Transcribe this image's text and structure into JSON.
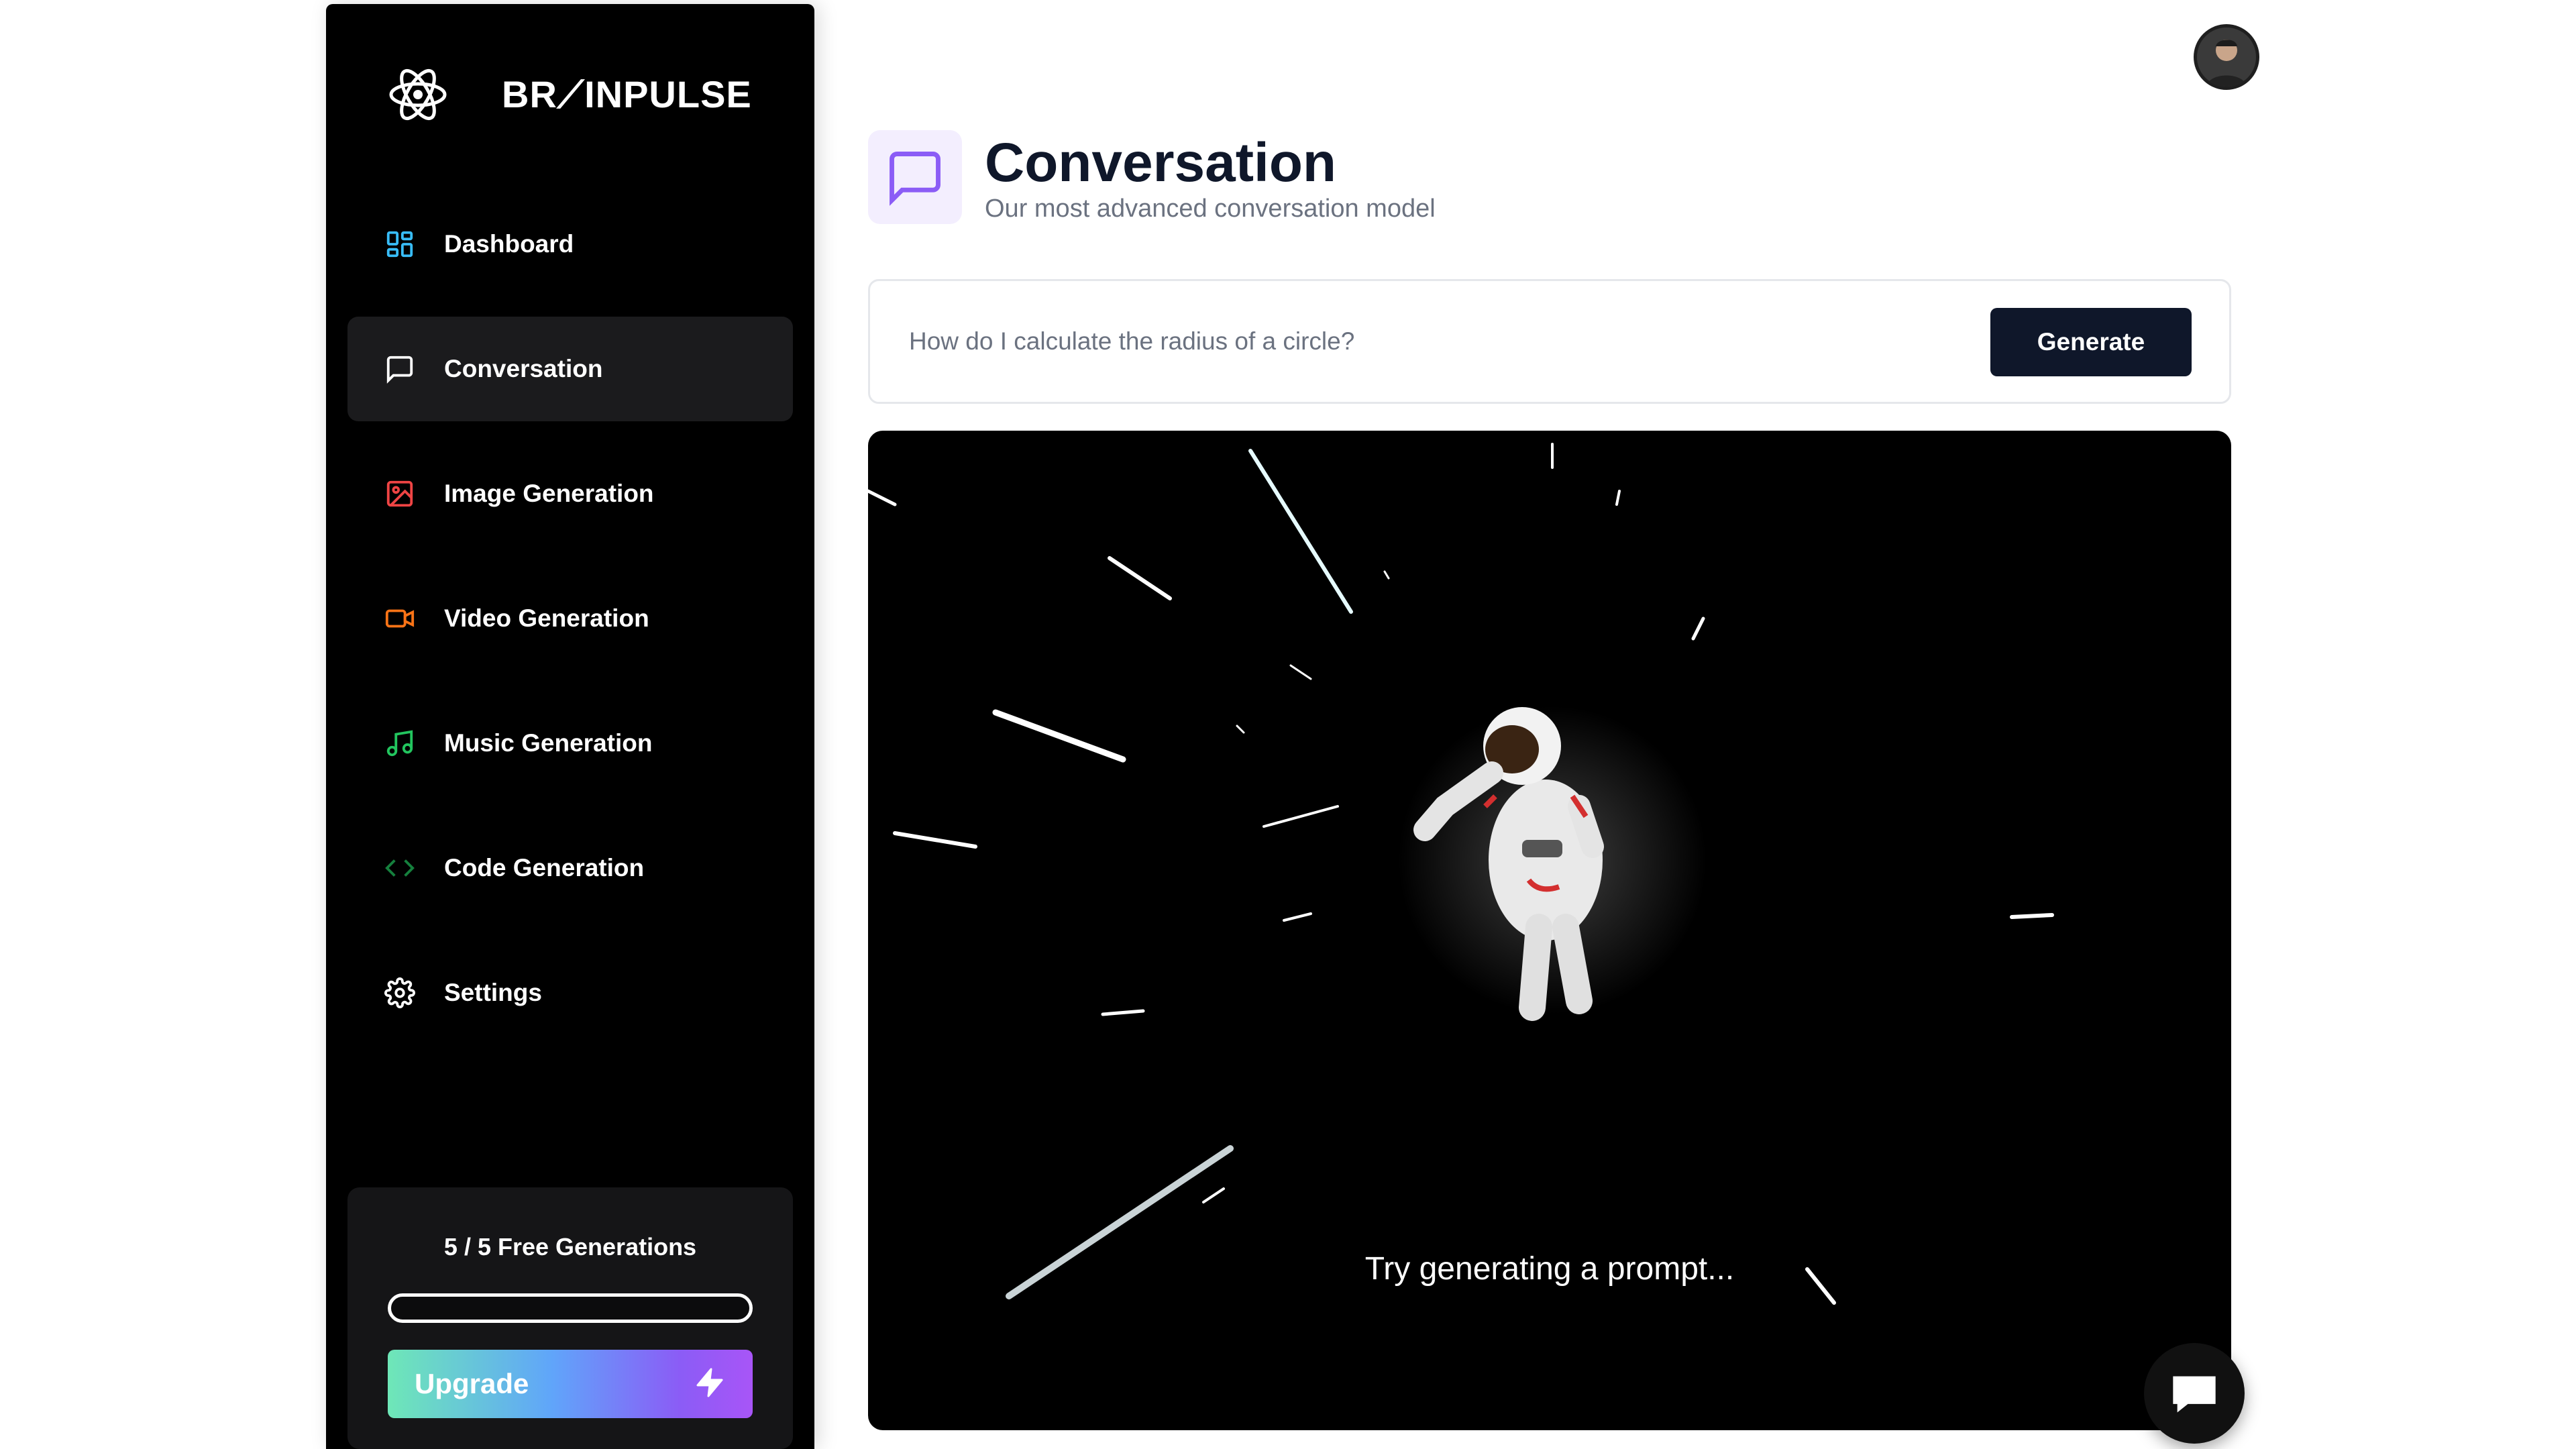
{
  "brand": {
    "name": "BR⟋INPULSE",
    "logo_icon": "atom-icon"
  },
  "sidebar": {
    "items": [
      {
        "label": "Dashboard",
        "icon": "dashboard-icon",
        "color": "#38bdf8",
        "active": false
      },
      {
        "label": "Conversation",
        "icon": "message-square-icon",
        "color": "#ffffff",
        "active": true
      },
      {
        "label": "Image Generation",
        "icon": "image-icon",
        "color": "#ef4444",
        "active": false
      },
      {
        "label": "Video Generation",
        "icon": "video-icon",
        "color": "#f97316",
        "active": false
      },
      {
        "label": "Music Generation",
        "icon": "music-icon",
        "color": "#22c55e",
        "active": false
      },
      {
        "label": "Code Generation",
        "icon": "code-icon",
        "color": "#15803d",
        "active": false
      },
      {
        "label": "Settings",
        "icon": "gear-icon",
        "color": "#ffffff",
        "active": false
      }
    ],
    "free_generations": {
      "label": "5 / 5 Free Generations",
      "progress": 0
    },
    "upgrade": {
      "label": "Upgrade",
      "icon": "zap-icon"
    }
  },
  "header": {
    "avatar_icon": "user-avatar"
  },
  "page": {
    "title": "Conversation",
    "subtitle": "Our most advanced conversation model",
    "icon": "message-square-icon",
    "accent": "#8b5cf6"
  },
  "prompt": {
    "placeholder": "How do I calculate the radius of a circle?",
    "value": "",
    "button_label": "Generate"
  },
  "empty_state": {
    "caption": "Try generating a prompt...",
    "illustration": "astronaut-hyperspace"
  },
  "chat_widget": {
    "icon": "chat-bubble-icon"
  }
}
